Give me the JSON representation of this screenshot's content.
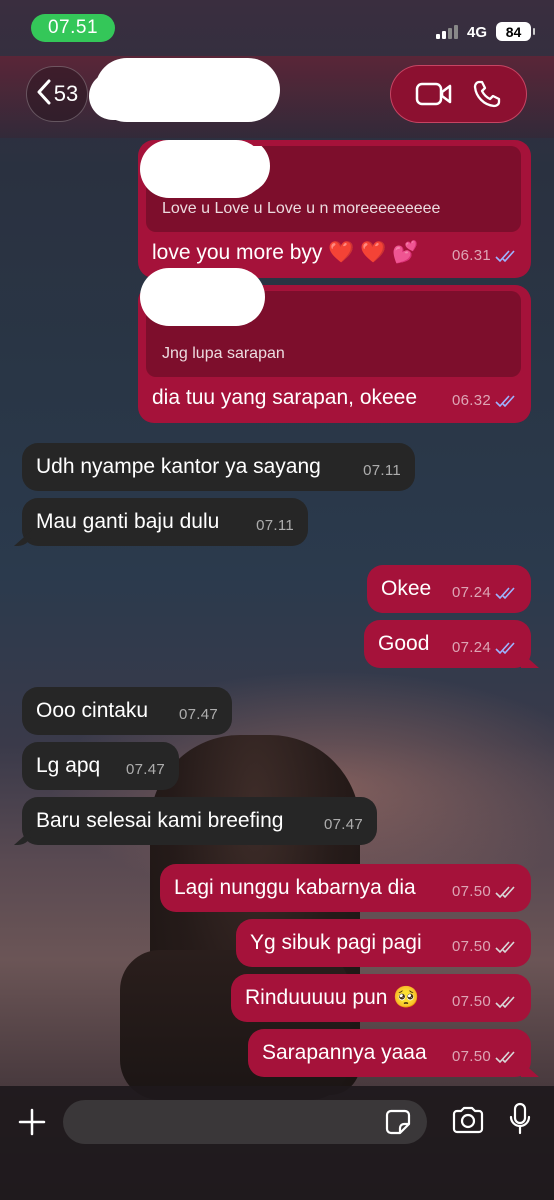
{
  "status_bar": {
    "time": "07.51",
    "network": "4G",
    "battery": "84"
  },
  "header": {
    "back_count": "53"
  },
  "messages": [
    {
      "dir": "out",
      "quote": "Love u Love u Love u n moreeeeeeeee",
      "text": "love you more byy ❤️ ❤️ 💕",
      "time": "06.31"
    },
    {
      "dir": "out",
      "quote": "Jng lupa sarapan",
      "text": "dia tuu yang sarapan, okeee",
      "time": "06.32"
    },
    {
      "dir": "in",
      "text": "Udh nyampe kantor ya sayang",
      "time": "07.11"
    },
    {
      "dir": "in",
      "text": "Mau ganti baju dulu",
      "time": "07.11"
    },
    {
      "dir": "out",
      "text": "Okee",
      "time": "07.24"
    },
    {
      "dir": "out",
      "text": "Good",
      "time": "07.24"
    },
    {
      "dir": "in",
      "text": "Ooo cintaku",
      "time": "07.47"
    },
    {
      "dir": "in",
      "text": "Lg apq",
      "time": "07.47"
    },
    {
      "dir": "in",
      "text": "Baru selesai kami breefing",
      "time": "07.47"
    },
    {
      "dir": "out",
      "text": "Lagi nunggu kabarnya dia",
      "time": "07.50"
    },
    {
      "dir": "out",
      "text": "Yg sibuk pagi pagi",
      "time": "07.50"
    },
    {
      "dir": "out",
      "text": "Rinduuuuu pun 🥺",
      "time": "07.50"
    },
    {
      "dir": "out",
      "text": "Sarapannya yaaa",
      "time": "07.50"
    }
  ],
  "colors": {
    "outgoing": "#a5123a",
    "incoming": "#262626",
    "read_ticks": "#9db4ff",
    "sent_ticks": "#d9d9d9",
    "status_pill": "#34c759"
  },
  "icons": [
    "chevron-left-icon",
    "video-call-icon",
    "phone-icon",
    "plus-icon",
    "sticker-icon",
    "camera-icon",
    "microphone-icon"
  ]
}
